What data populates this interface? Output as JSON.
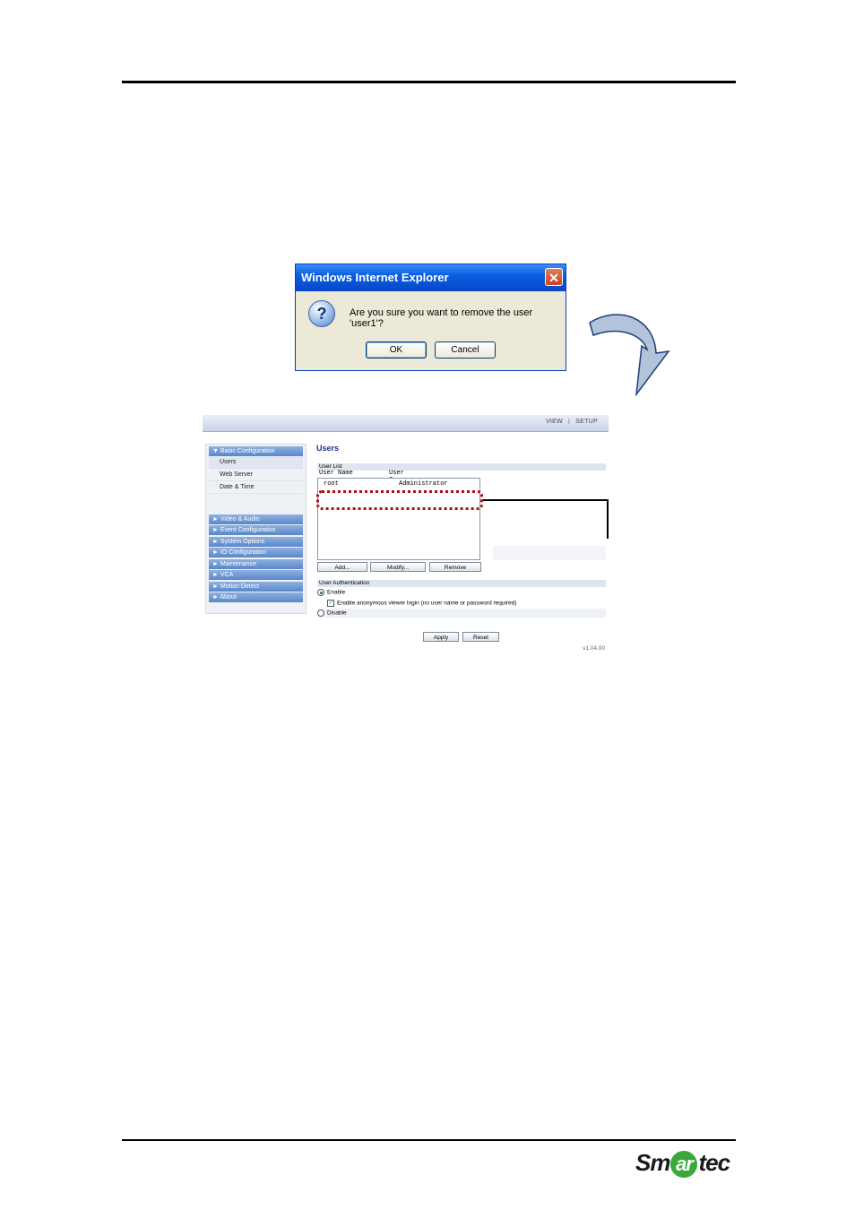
{
  "dialog": {
    "title": "Windows Internet Explorer",
    "close_glyph": "✕",
    "icon_glyph": "?",
    "message": "Are you sure you want to remove the user 'user1'?",
    "ok_label": "OK",
    "cancel_label": "Cancel"
  },
  "web_ui": {
    "topnav": {
      "view": "VIEW",
      "separator": "|",
      "setup": "SETUP"
    },
    "sidebar": {
      "group": "▼  Basic Configuration",
      "subitems": [
        "Users",
        "Web Server",
        "Date & Time"
      ],
      "items": [
        "►  Video & Audio",
        "►  Event Configuration",
        "►  System Options",
        "►  IO Configuration",
        "►  Maintenance",
        "►  VCA",
        "►  Motion Detect",
        "►  About"
      ]
    },
    "page_title": "Users",
    "user_list": {
      "section": "User List",
      "col_user": "User Name",
      "col_group": "User Group",
      "row_user": "root",
      "row_group": "Administrator",
      "add_label": "Add...",
      "modify_label": "Modify...",
      "remove_label": "Remove"
    },
    "auth": {
      "section": "User Authentication",
      "enable_label": "Enable",
      "anon_label": "Enable anonymous viewer login (no user name or password required)",
      "disable_label": "Disable",
      "enable_selected": true,
      "anon_checked": true
    },
    "apply_label": "Apply",
    "reset_label": "Reset",
    "version": "v1.04.00"
  },
  "logo": {
    "part1": "Sm",
    "part2": "ar",
    "part3": "tec"
  },
  "colors": {
    "marker": "#b01010",
    "nav_blue": "#5a86c9",
    "ie_title": "#0a5fe0",
    "logo_green": "#3aa83a"
  }
}
